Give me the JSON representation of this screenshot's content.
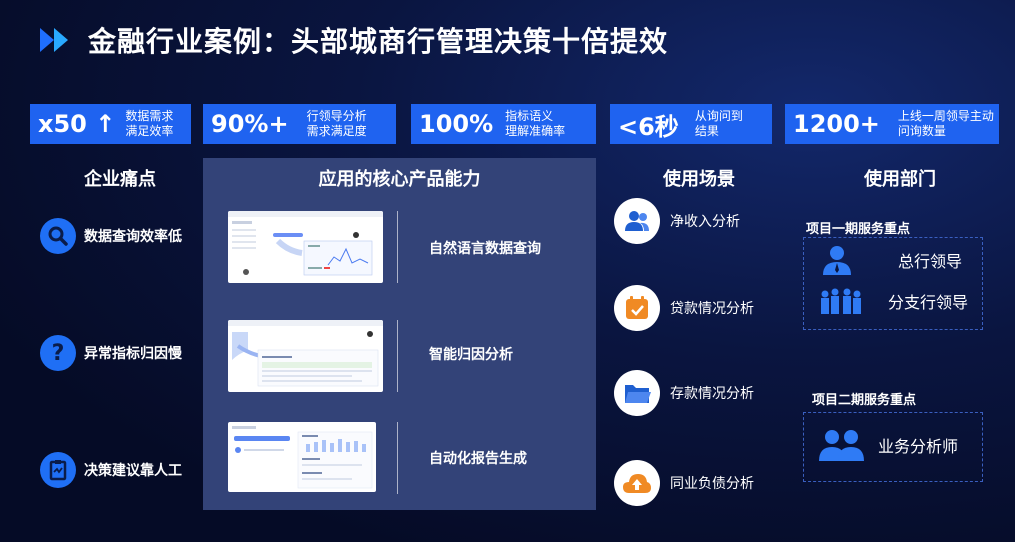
{
  "title": "金融行业案例：头部城商行管理决策十倍提效",
  "metrics": [
    {
      "value": "x50 ↑",
      "desc1": "数据需求",
      "desc2": "满足效率"
    },
    {
      "value": "90%+",
      "desc1": "行领导分析",
      "desc2": "需求满足度"
    },
    {
      "value": "100%",
      "desc1": "指标语义",
      "desc2": "理解准确率"
    },
    {
      "value": "<6秒",
      "desc1": "从询问到",
      "desc2": "结果"
    },
    {
      "value": "1200+",
      "desc1": "上线一周领导主动",
      "desc2": "问询数量"
    }
  ],
  "pain_points": {
    "heading": "企业痛点",
    "items": [
      {
        "label": "数据查询效率低",
        "icon": "search-icon"
      },
      {
        "label": "异常指标归因慢",
        "icon": "question-icon"
      },
      {
        "label": "决策建议靠人工",
        "icon": "clipboard-icon"
      }
    ]
  },
  "core": {
    "heading": "应用的核心产品能力",
    "items": [
      {
        "label": "自然语言数据查询"
      },
      {
        "label": "智能归因分析"
      },
      {
        "label": "自动化报告生成"
      }
    ]
  },
  "scenes": {
    "heading": "使用场景",
    "items": [
      {
        "label": "净收入分析",
        "icon": "users-icon"
      },
      {
        "label": "贷款情况分析",
        "icon": "calendar-icon"
      },
      {
        "label": "存款情况分析",
        "icon": "folder-icon"
      },
      {
        "label": "同业负债分析",
        "icon": "cloud-upload-icon"
      }
    ]
  },
  "departments": {
    "heading": "使用部门",
    "phase1": {
      "title": "项目一期服务重点",
      "items": [
        "总行领导",
        "分支行领导"
      ]
    },
    "phase2": {
      "title": "项目二期服务重点",
      "items": [
        "业务分析师"
      ]
    }
  },
  "colors": {
    "accent": "#1f63f0",
    "panel": "#334378",
    "background": "#050b26"
  }
}
